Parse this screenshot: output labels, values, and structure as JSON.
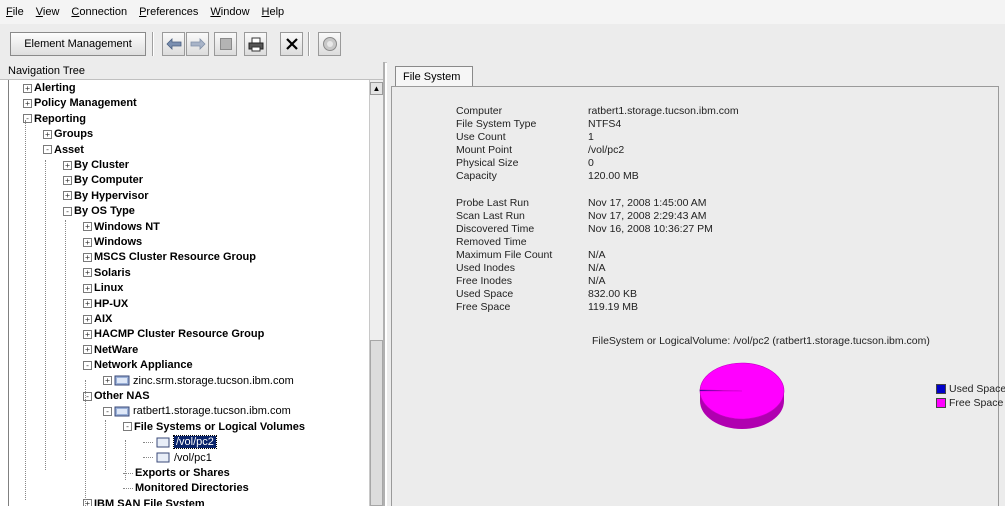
{
  "menu": {
    "items": [
      "File",
      "View",
      "Connection",
      "Preferences",
      "Window",
      "Help"
    ]
  },
  "toolbar": {
    "element_management_label": "Element Management",
    "icons": [
      "back-arrow-icon",
      "forward-arrow-icon",
      "stop-icon",
      "print-icon",
      "close-icon",
      "cancel-icon"
    ]
  },
  "nav": {
    "header": "Navigation Tree",
    "rows": [
      {
        "label": "Alerting",
        "bold": true,
        "expander": "+"
      },
      {
        "label": "Policy Management",
        "bold": true,
        "expander": "+"
      },
      {
        "label": "Reporting",
        "bold": true,
        "expander": "-"
      },
      {
        "label": "Groups",
        "bold": true,
        "expander": "+"
      },
      {
        "label": "Asset",
        "bold": true,
        "expander": "-"
      },
      {
        "label": "By Cluster",
        "bold": true,
        "expander": "+"
      },
      {
        "label": "By Computer",
        "bold": true,
        "expander": "+"
      },
      {
        "label": "By Hypervisor",
        "bold": true,
        "expander": "+"
      },
      {
        "label": "By OS Type",
        "bold": true,
        "expander": "-"
      },
      {
        "label": "Windows NT",
        "bold": true,
        "expander": "+"
      },
      {
        "label": "Windows",
        "bold": true,
        "expander": "+"
      },
      {
        "label": "MSCS Cluster Resource Group",
        "bold": true,
        "expander": "+"
      },
      {
        "label": "Solaris",
        "bold": true,
        "expander": "+"
      },
      {
        "label": "Linux",
        "bold": true,
        "expander": "+"
      },
      {
        "label": "HP-UX",
        "bold": true,
        "expander": "+"
      },
      {
        "label": "AIX",
        "bold": true,
        "expander": "+"
      },
      {
        "label": "HACMP Cluster Resource Group",
        "bold": true,
        "expander": "+"
      },
      {
        "label": "NetWare",
        "bold": true,
        "expander": "+"
      },
      {
        "label": "Network Appliance",
        "bold": true,
        "expander": "-"
      },
      {
        "label": "zinc.srm.storage.tucson.ibm.com",
        "bold": false,
        "expander": "+",
        "icon": "computer"
      },
      {
        "label": "Other NAS",
        "bold": true,
        "expander": "-"
      },
      {
        "label": "ratbert1.storage.tucson.ibm.com",
        "bold": false,
        "expander": "-",
        "icon": "computer"
      },
      {
        "label": "File Systems or Logical Volumes",
        "bold": true,
        "expander": "-"
      },
      {
        "label": "/vol/pc2",
        "bold": false,
        "expander": "",
        "icon": "folder",
        "selected": true
      },
      {
        "label": "/vol/pc1",
        "bold": false,
        "expander": "",
        "icon": "folder"
      },
      {
        "label": "Exports or Shares",
        "bold": true,
        "expander": ""
      },
      {
        "label": "Monitored Directories",
        "bold": true,
        "expander": ""
      },
      {
        "label": "IBM SAN File System",
        "bold": true,
        "expander": "+"
      }
    ]
  },
  "content": {
    "tab_label": "File System",
    "properties": [
      {
        "label": "Computer",
        "value": "ratbert1.storage.tucson.ibm.com"
      },
      {
        "label": "File System Type",
        "value": "NTFS4"
      },
      {
        "label": "Use Count",
        "value": "1"
      },
      {
        "label": "Mount Point",
        "value": "/vol/pc2"
      },
      {
        "label": "Physical Size",
        "value": "0"
      },
      {
        "label": "Capacity",
        "value": "120.00 MB"
      },
      {
        "label": "Probe Last Run",
        "value": "Nov 17, 2008 1:45:00 AM"
      },
      {
        "label": "Scan Last Run",
        "value": "Nov 17, 2008 2:29:43 AM"
      },
      {
        "label": "Discovered Time",
        "value": "Nov 16, 2008 10:36:27 PM"
      },
      {
        "label": "Removed Time",
        "value": ""
      },
      {
        "label": "Maximum File Count",
        "value": "N/A"
      },
      {
        "label": "Used Inodes",
        "value": "N/A"
      },
      {
        "label": "Free Inodes",
        "value": "N/A"
      },
      {
        "label": "Used Space",
        "value": "832.00 KB"
      },
      {
        "label": "Free Space",
        "value": "119.19 MB"
      }
    ]
  },
  "chart_data": {
    "type": "pie",
    "title": "FileSystem or LogicalVolume: /vol/pc2    (ratbert1.storage.tucson.ibm.com)",
    "categories": [
      "Used Space",
      "Free Space"
    ],
    "values": [
      0.81,
      119.19
    ],
    "colors": [
      "#0000c8",
      "#ff00ff"
    ],
    "legend_position": "right"
  }
}
